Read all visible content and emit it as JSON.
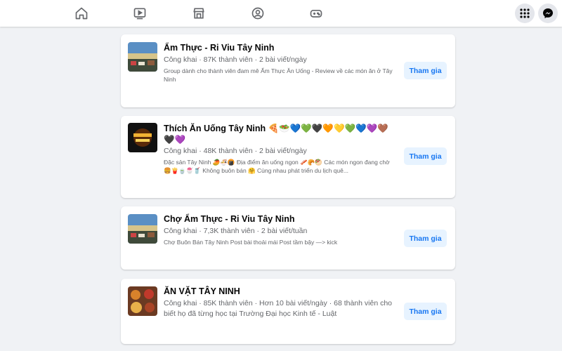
{
  "nav": {
    "icons": [
      "home-icon",
      "watch-icon",
      "marketplace-icon",
      "groups-icon",
      "gaming-icon"
    ],
    "right": [
      "menu-grid-icon",
      "messenger-icon"
    ]
  },
  "colors": {
    "accent": "#1877f2",
    "button_bg": "#e7f3ff",
    "meta_text": "#65676b",
    "page_bg": "#f0f2f5"
  },
  "groups": [
    {
      "name": "Ẩm Thực - Ri Viu Tây Ninh",
      "meta": "Công khai · 87K thành viên · 2 bài viết/ngày",
      "description": "Group dành cho thành viên đam mê Ẩm Thực Ăn Uống - Review về các món ăn ở Tây Ninh",
      "join_label": "Tham gia"
    },
    {
      "name": "Thích Ăn Uống Tây Ninh 🍕🥗💙💚🖤🧡💛💚💙💜🤎🖤💜",
      "meta": "Công khai · 48K thành viên · 2 bài viết/ngày",
      "description": "Đặc sản Tây Ninh 🥭🍜🍘 Địa điểm ăn uống ngon 🥓🥐🥙 Các món ngon đang chờ 🍔🍟🍵🍧🥤 Không buôn bán 🤗 Cùng nhau phát triển du lịch quê...",
      "join_label": "Tham gia"
    },
    {
      "name": "Chợ Ẩm Thực - Ri Viu Tây Ninh",
      "meta": "Công khai · 7,3K thành viên · 2 bài viết/tuần",
      "description": "Chợ Buôn Bán Tây Ninh Post bài thoải mái Post tầm bậy —> kick",
      "join_label": "Tham gia"
    },
    {
      "name": "ĂN VẶT TÂY NINH",
      "meta": "Công khai · 85K thành viên · Hơn 10 bài viết/ngày · 68 thành viên cho biết họ đã từng học tại Trường Đại học Kinh tế - Luật",
      "description": "",
      "join_label": "Tham gia"
    }
  ]
}
